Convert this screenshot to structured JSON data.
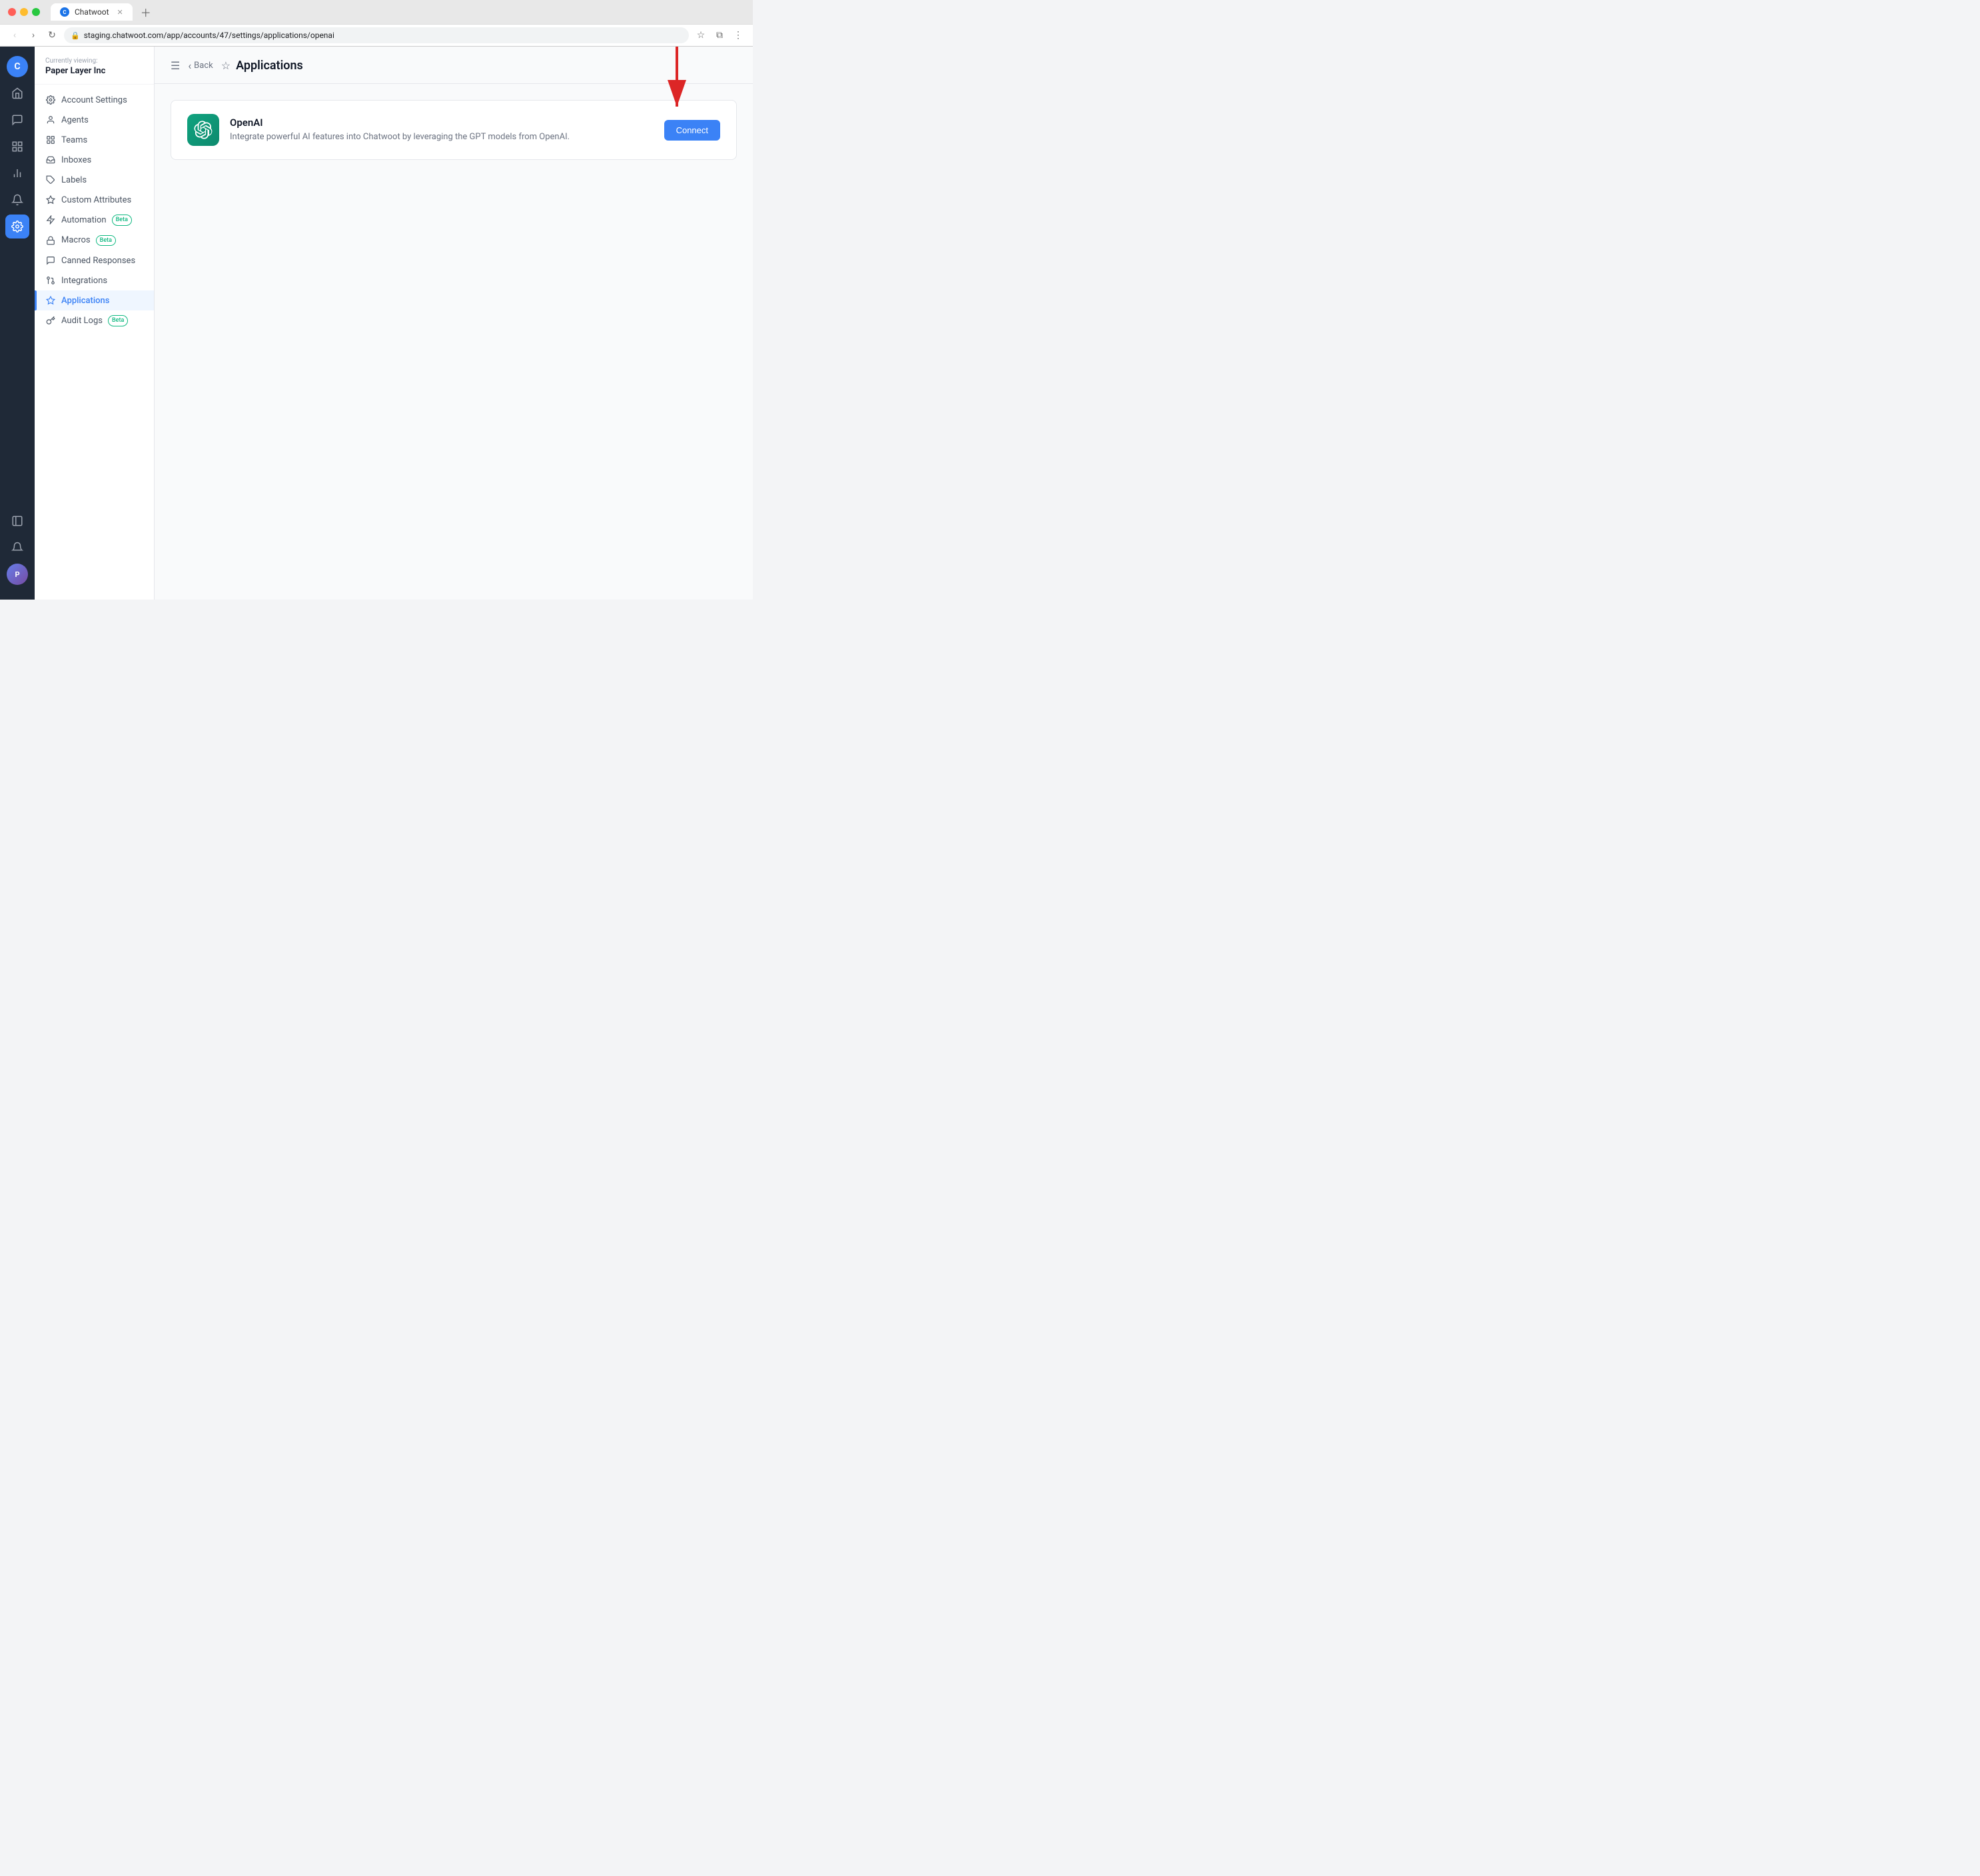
{
  "browser": {
    "tab_title": "Chatwoot",
    "url": "staging.chatwoot.com/app/accounts/47/settings/applications/openai",
    "favicon_letter": "C"
  },
  "sidebar": {
    "icons": [
      {
        "name": "home",
        "symbol": "⌂",
        "active": false
      },
      {
        "name": "messages",
        "symbol": "💬",
        "active": false
      },
      {
        "name": "contacts",
        "symbol": "◻",
        "active": false
      },
      {
        "name": "reports",
        "symbol": "📊",
        "active": false
      },
      {
        "name": "notifications",
        "symbol": "🔔",
        "active": false
      },
      {
        "name": "settings",
        "symbol": "⚙",
        "active": true
      }
    ],
    "bottom_icons": [
      {
        "name": "expand",
        "symbol": "⊞"
      },
      {
        "name": "bell",
        "symbol": "🔔"
      }
    ]
  },
  "left_nav": {
    "currently_viewing_label": "Currently viewing:",
    "org_name": "Paper Layer Inc",
    "menu_items": [
      {
        "id": "account-settings",
        "label": "Account Settings",
        "icon": "⚙",
        "active": false
      },
      {
        "id": "agents",
        "label": "Agents",
        "icon": "👤",
        "active": false
      },
      {
        "id": "teams",
        "label": "Teams",
        "icon": "⊞",
        "active": false
      },
      {
        "id": "inboxes",
        "label": "Inboxes",
        "icon": "📥",
        "active": false
      },
      {
        "id": "labels",
        "label": "Labels",
        "icon": "🏷",
        "active": false
      },
      {
        "id": "custom-attributes",
        "label": "Custom Attributes",
        "icon": "◇",
        "active": false
      },
      {
        "id": "automation",
        "label": "Automation",
        "icon": "⚡",
        "active": false,
        "badge": "Beta"
      },
      {
        "id": "macros",
        "label": "Macros",
        "icon": "🔒",
        "active": false,
        "badge": "Beta"
      },
      {
        "id": "canned-responses",
        "label": "Canned Responses",
        "icon": "💬",
        "active": false
      },
      {
        "id": "integrations",
        "label": "Integrations",
        "icon": "🔗",
        "active": false
      },
      {
        "id": "applications",
        "label": "Applications",
        "icon": "✦",
        "active": true
      },
      {
        "id": "audit-logs",
        "label": "Audit Logs",
        "icon": "🔑",
        "active": false,
        "badge": "Beta"
      }
    ]
  },
  "page": {
    "header": {
      "back_label": "Back",
      "title": "Applications",
      "star_icon": "☆"
    },
    "app_card": {
      "name": "OpenAI",
      "description": "Integrate powerful AI features into Chatwoot by leveraging the GPT models from OpenAI.",
      "connect_button": "Connect"
    }
  }
}
